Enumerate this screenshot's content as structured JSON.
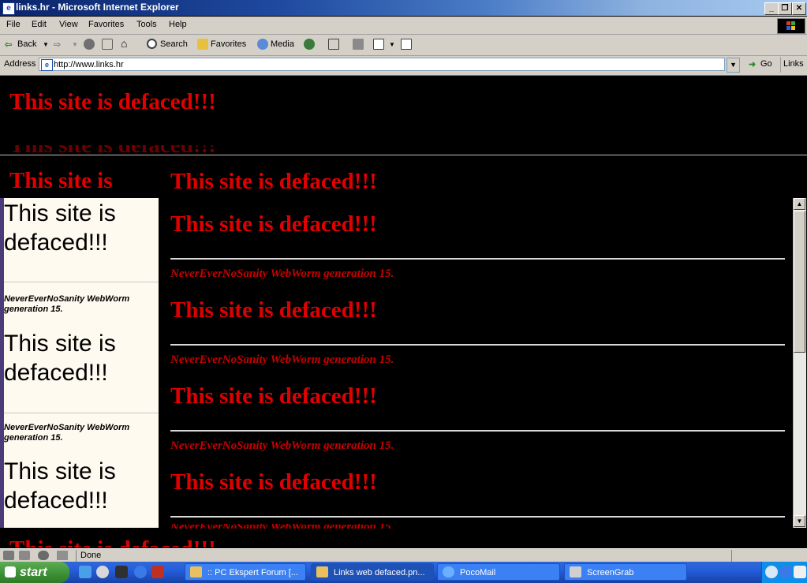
{
  "window": {
    "title": "links.hr - Microsoft Internet Explorer",
    "min": "_",
    "max": "❐",
    "close": "✕"
  },
  "menu": [
    "File",
    "Edit",
    "View",
    "Favorites",
    "Tools",
    "Help"
  ],
  "toolbar": {
    "back": "Back",
    "search": "Search",
    "favorites": "Favorites",
    "media": "Media"
  },
  "address": {
    "label": "Address",
    "url": "http://www.links.hr",
    "go": "Go",
    "links": "Links"
  },
  "page": {
    "headline": "This site is defaced!!!",
    "worm": "NeverEverNoSanity WebWorm generation 15.",
    "left_big": "This site is defaced!!!",
    "left_small": "NeverEverNoSanity WebWorm generation 15.",
    "top_partial": "This site is",
    "colors": {
      "background": "#000000",
      "headline": "#e00000",
      "left_frame": "#fffaf0"
    }
  },
  "status": {
    "text": "Done"
  },
  "taskbar": {
    "start": "start",
    "tasks": [
      ":: PC Ekspert Forum [...",
      "Links web defaced.pn...",
      "PocoMail",
      "ScreenGrab"
    ]
  }
}
